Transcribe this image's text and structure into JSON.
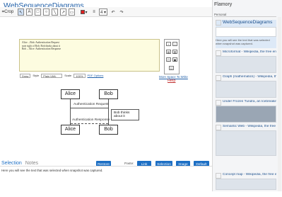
{
  "app": {
    "title": "WebSequenceDiagrams"
  },
  "toolbar": {
    "crop_label": "Crop",
    "zoom_label": "4 ▾",
    "undo": "↶",
    "redo": "↷"
  },
  "editor": {
    "lines": [
      "Alice→Bob: Authentication Request",
      "note right of Bob: Bob thinks about it",
      "Bob→Alice: Authentication Response"
    ]
  },
  "options": {
    "draw_label": "Draw",
    "style_label": "Style",
    "style_value": "Plain UML",
    "scale_label": "Scale",
    "scale_value": "100%",
    "pdf_link": "PDF Options"
  },
  "side_links": {
    "more_space": "More Space To Write",
    "help": "Help"
  },
  "diagram": {
    "actor1": "Alice",
    "actor2": "Bob",
    "msg1": "Authentication Request",
    "note": "Bob thinks about it",
    "msg2": "Authentication Response"
  },
  "bottom": {
    "tab_selection": "Selection",
    "tab_notes": "Notes",
    "paste_label": "Paste:",
    "restore": "Restore",
    "link": "Link",
    "selection": "Selection",
    "image": "Image",
    "default": "Default",
    "panel_text": "Here you will see the text that was selected when snapshot was captured."
  },
  "sidebar": {
    "title": "Flamory",
    "section": "Personal",
    "items": [
      {
        "title": "WebSequenceDiagrams",
        "desc": "Here you will see the text that was selected when snapshot was captured."
      },
      {
        "title": "Microformat - Wikipedia, the free encyclopedia"
      },
      {
        "title": "Graph (mathematics) - Wikipedia, the free encyclopedia"
      },
      {
        "title": "Under Frozen Tundra, an Icebreaking Ship Unco..."
      },
      {
        "title": "Semantic Web - Wikipedia, the free encyclopedia"
      },
      {
        "title": "Concept map - Wikipedia, the free encyclopedia"
      }
    ]
  },
  "colors": {
    "accent": "#1d6fc4",
    "editor_bg": "#fdfce0"
  }
}
